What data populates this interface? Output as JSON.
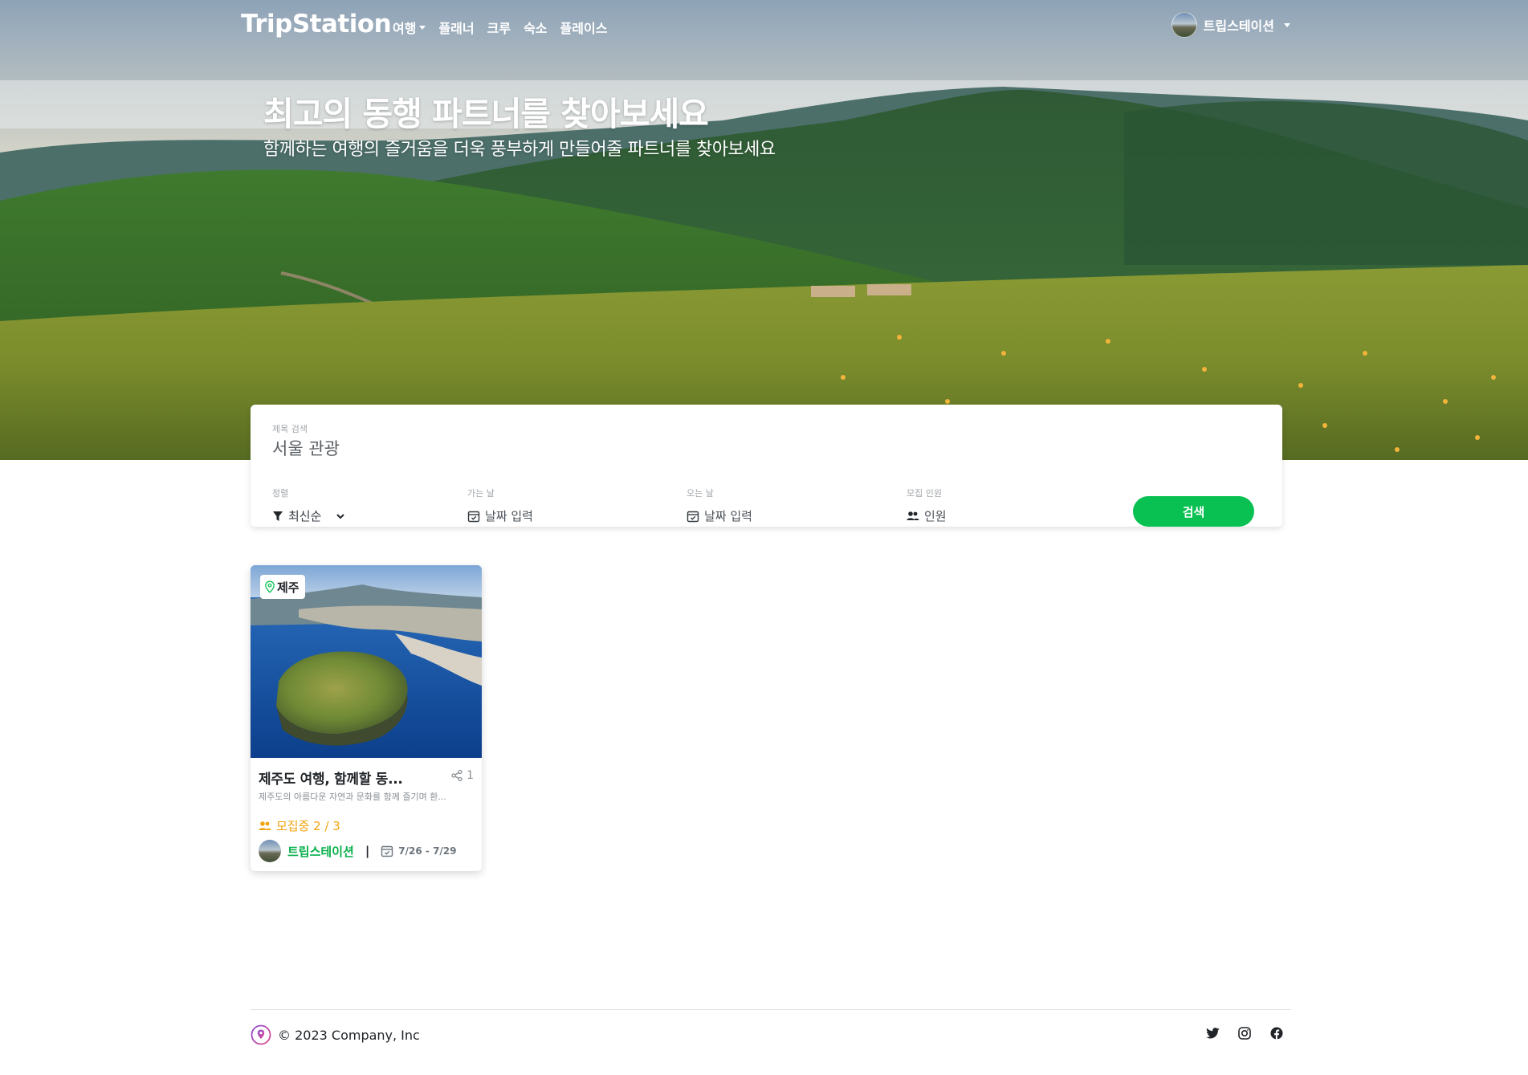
{
  "nav": {
    "brand": "TripStation",
    "menu": [
      {
        "label": "여행",
        "dropdown": true
      },
      {
        "label": "플래너",
        "dropdown": false
      },
      {
        "label": "크루",
        "dropdown": false
      },
      {
        "label": "숙소",
        "dropdown": false
      },
      {
        "label": "플레이스",
        "dropdown": false
      }
    ],
    "user_name": "트립스테이션"
  },
  "hero": {
    "title": "최고의 동행 파트너를 찾아보세요",
    "subtitle": "함께하는 여행의 즐거움을 더욱 풍부하게 만들어줄 파트너를 찾아보세요"
  },
  "search": {
    "title_label": "제목 검색",
    "title_value": "서울 관광",
    "sort_label": "정렬",
    "sort_value": "최신순",
    "depart_label": "가는 날",
    "depart_placeholder": "날짜 입력",
    "return_label": "오는 날",
    "return_placeholder": "날짜 입력",
    "people_label": "모집 인원",
    "people_placeholder": "인원",
    "button": "검색",
    "accent_color": "#08c152"
  },
  "cards": [
    {
      "region": "제주",
      "title": "제주도 여행, 함께할 동...",
      "share_count": "1",
      "description": "제주도의 아름다운 자연과 문화를 함께 즐기며 환...",
      "status": "모집중 2 / 3",
      "host": "트립스테이션",
      "separator": "|",
      "dates": "7/26 - 7/29"
    }
  ],
  "footer": {
    "copyright": "© 2023 Company, Inc",
    "social": [
      "twitter-icon",
      "instagram-icon",
      "facebook-icon"
    ]
  },
  "colors": {
    "green": "#08c152",
    "orange": "#f2a30f",
    "host_green": "#08b04b"
  }
}
